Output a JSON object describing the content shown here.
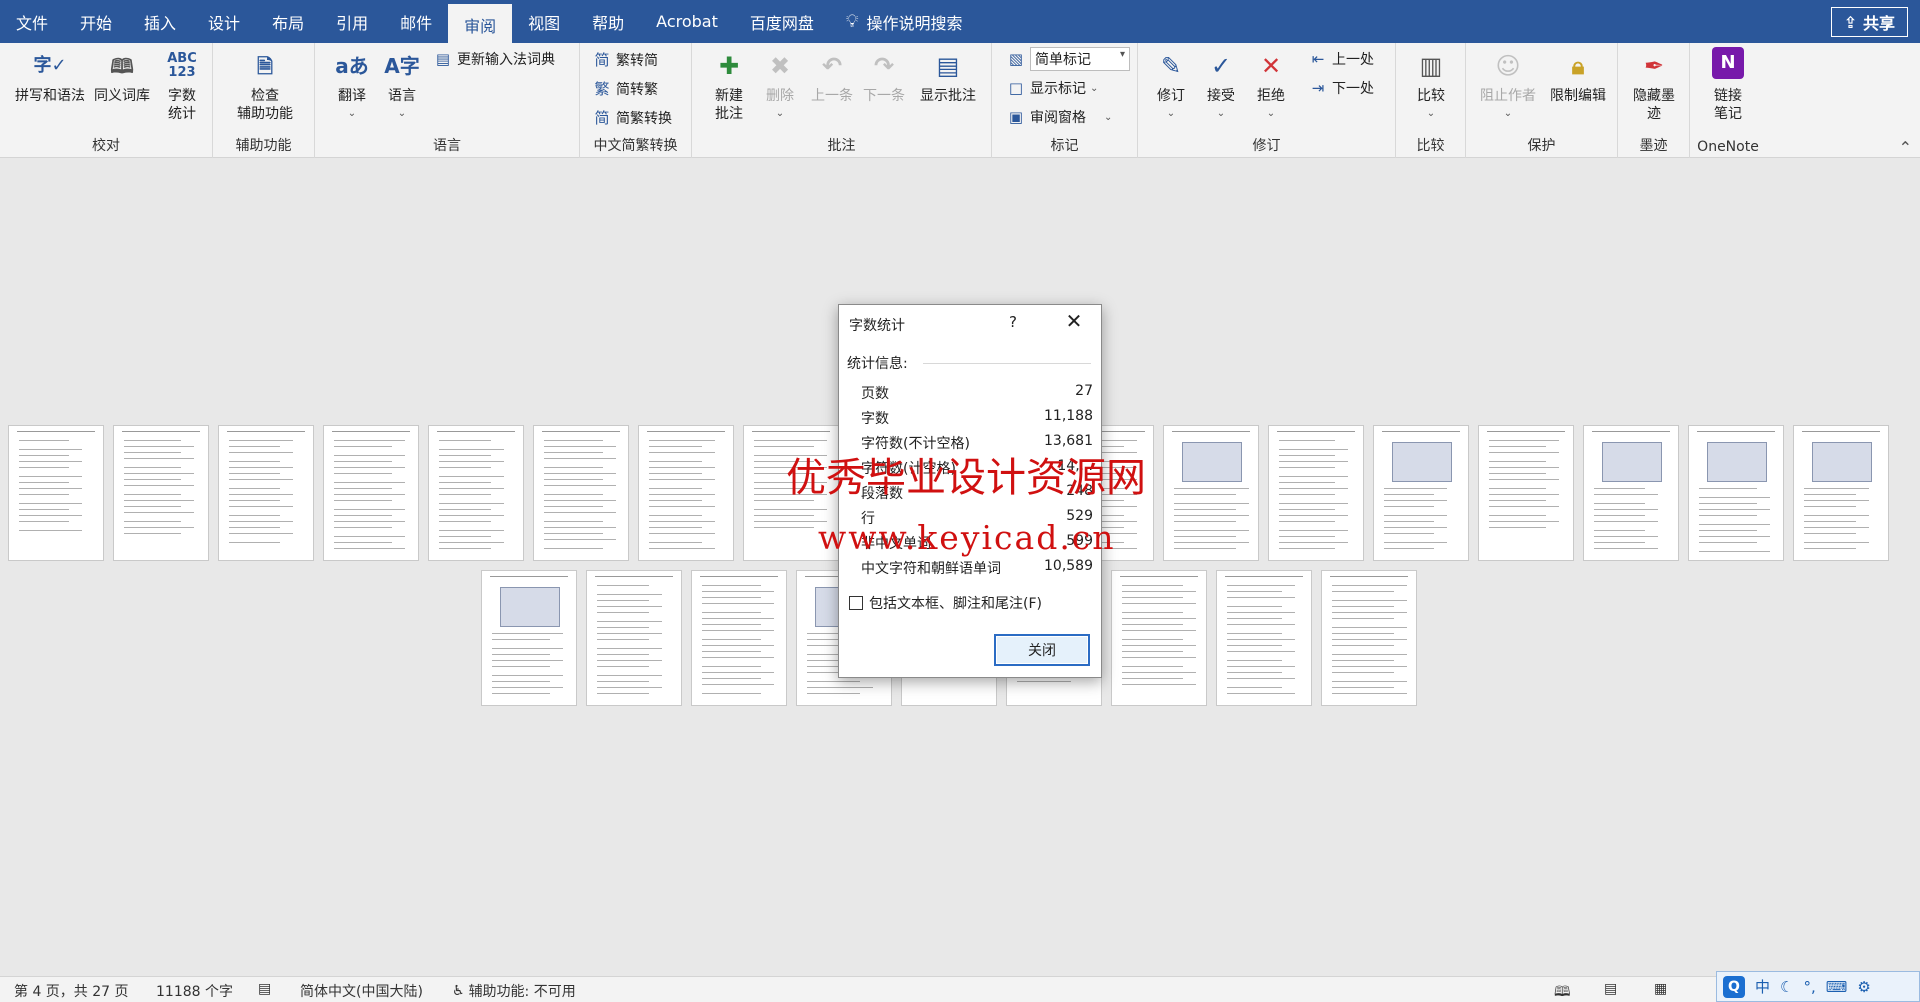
{
  "menubar": {
    "tabs": [
      "文件",
      "开始",
      "插入",
      "设计",
      "布局",
      "引用",
      "邮件",
      "审阅",
      "视图",
      "帮助",
      "Acrobat",
      "百度网盘"
    ],
    "active_tab": "审阅",
    "search_label": "操作说明搜索",
    "share_label": "共享"
  },
  "ribbon": {
    "proofing": {
      "label": "校对",
      "spelling": "拼写和语法",
      "thesaurus": "同义词库",
      "wordcount_line1": "字数",
      "wordcount_line2": "统计",
      "wordcount_icon": "ABC\n123"
    },
    "accessibility": {
      "label": "辅助功能",
      "check_line1": "检查",
      "check_line2": "辅助功能"
    },
    "language": {
      "label": "语言",
      "translate": "翻译",
      "language": "语言",
      "update_ime": "更新输入法词典"
    },
    "chinese": {
      "label": "中文简繁转换",
      "to_trad": "繁转简",
      "to_simp": "简转繁",
      "convert": "简繁转换"
    },
    "comments": {
      "label": "批注",
      "new_line1": "新建",
      "new_line2": "批注",
      "delete": "删除",
      "prev": "上一条",
      "next": "下一条",
      "show": "显示批注"
    },
    "tracking": {
      "label": "标记",
      "markup_select": "简单标记",
      "show_markup": "显示标记",
      "reviewing_pane": "审阅窗格"
    },
    "changes": {
      "label": "修订",
      "track": "修订",
      "accept": "接受",
      "reject": "拒绝",
      "prev": "上一处",
      "next": "下一处"
    },
    "compare": {
      "label": "比较",
      "compare": "比较"
    },
    "protect": {
      "label": "保护",
      "block_authors": "阻止作者",
      "restrict": "限制编辑"
    },
    "ink": {
      "label": "墨迹",
      "hide_line1": "隐藏墨",
      "hide_line2": "迹"
    },
    "onenote": {
      "label": "OneNote",
      "link_line1": "链接",
      "link_line2": "笔记"
    }
  },
  "watermark": {
    "line1": "优秀毕业设计资源网",
    "line2": "www.keyicad.cn"
  },
  "dialog": {
    "title": "字数统计",
    "help": "?",
    "section": "统计信息:",
    "stats": [
      {
        "label": "页数",
        "value": "27"
      },
      {
        "label": "字数",
        "value": "11,188"
      },
      {
        "label": "字符数(不计空格)",
        "value": "13,681"
      },
      {
        "label": "字符数(计空格)",
        "value": "14,..."
      },
      {
        "label": "段落数",
        "value": "248"
      },
      {
        "label": "行",
        "value": "529"
      },
      {
        "label": "非中文单词",
        "value": "599"
      },
      {
        "label": "中文字符和朝鲜语单词",
        "value": "10,589"
      }
    ],
    "checkbox_label": "包括文本框、脚注和尾注(F)",
    "close_button": "关闭"
  },
  "status": {
    "page": "第 4 页，共 27 页",
    "words": "11188 个字",
    "lang": "简体中文(中国大陆)",
    "accessibility": "辅助功能: 不可用"
  },
  "ime": {
    "mode": "中"
  }
}
